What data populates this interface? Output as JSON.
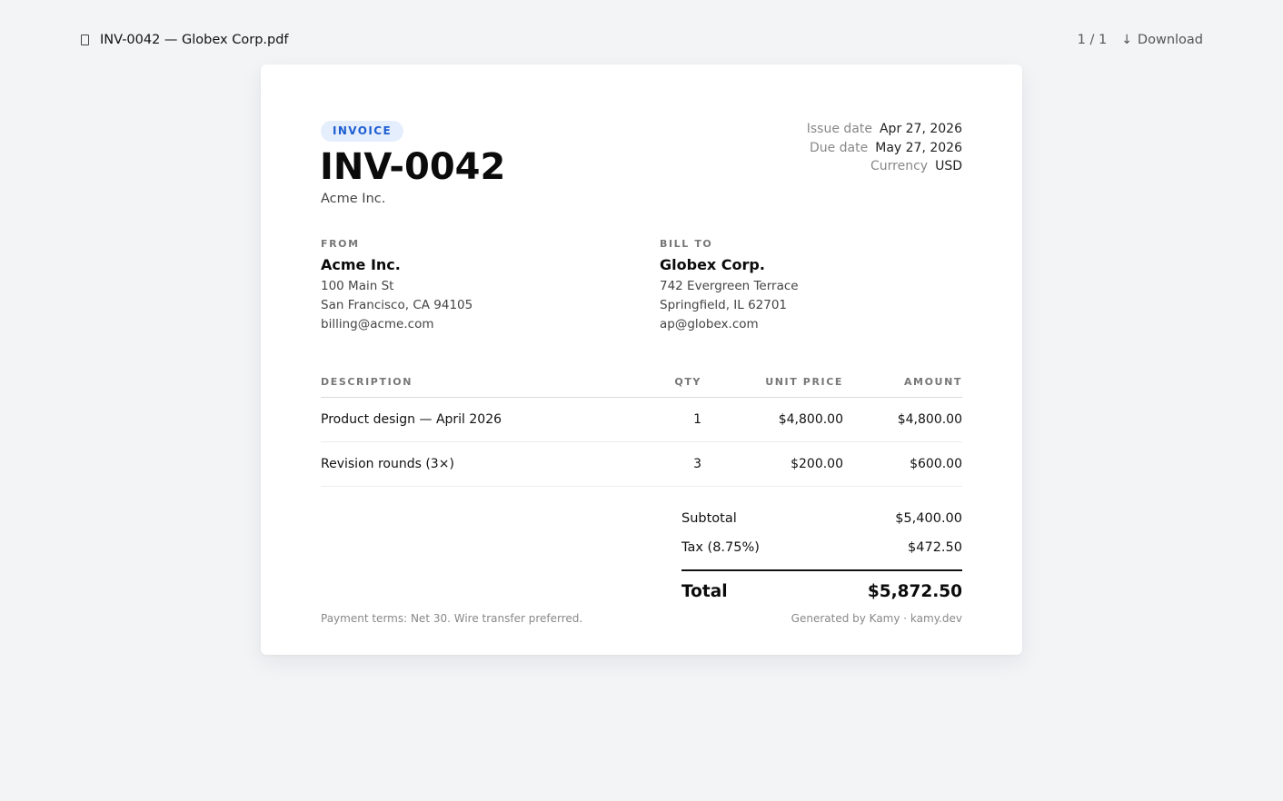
{
  "viewer": {
    "file_icon": "document-icon",
    "file_name": "INV-0042 — Globex Corp.pdf",
    "page_indicator": "1 / 1",
    "download_icon": "↓",
    "download_label": "Download"
  },
  "invoice": {
    "badge": "INVOICE",
    "number": "INV-0042",
    "issuer": "Acme Inc.",
    "meta": [
      {
        "label": "Issue date",
        "value": "Apr 27, 2026"
      },
      {
        "label": "Due date",
        "value": "May 27, 2026"
      },
      {
        "label": "Currency",
        "value": "USD"
      }
    ],
    "from": {
      "label": "FROM",
      "name": "Acme Inc.",
      "lines": [
        "100 Main St",
        "San Francisco, CA 94105",
        "billing@acme.com"
      ]
    },
    "bill_to": {
      "label": "BILL TO",
      "name": "Globex Corp.",
      "lines": [
        "742 Evergreen Terrace",
        "Springfield, IL 62701",
        "ap@globex.com"
      ]
    },
    "table": {
      "headers": {
        "description": "DESCRIPTION",
        "qty": "QTY",
        "unit_price": "UNIT PRICE",
        "amount": "AMOUNT"
      },
      "rows": [
        {
          "description": "Product design — April 2026",
          "qty": "1",
          "unit_price": "$4,800.00",
          "amount": "$4,800.00"
        },
        {
          "description": "Revision rounds (3×)",
          "qty": "3",
          "unit_price": "$200.00",
          "amount": "$600.00"
        }
      ]
    },
    "totals": {
      "subtotal_label": "Subtotal",
      "subtotal_value": "$5,400.00",
      "tax_label": "Tax (8.75%)",
      "tax_value": "$472.50",
      "total_label": "Total",
      "total_value": "$5,872.50"
    },
    "footer": {
      "payment_terms": "Payment terms: Net 30. Wire transfer preferred.",
      "generated_by": "Generated by Kamy · kamy.dev"
    }
  }
}
